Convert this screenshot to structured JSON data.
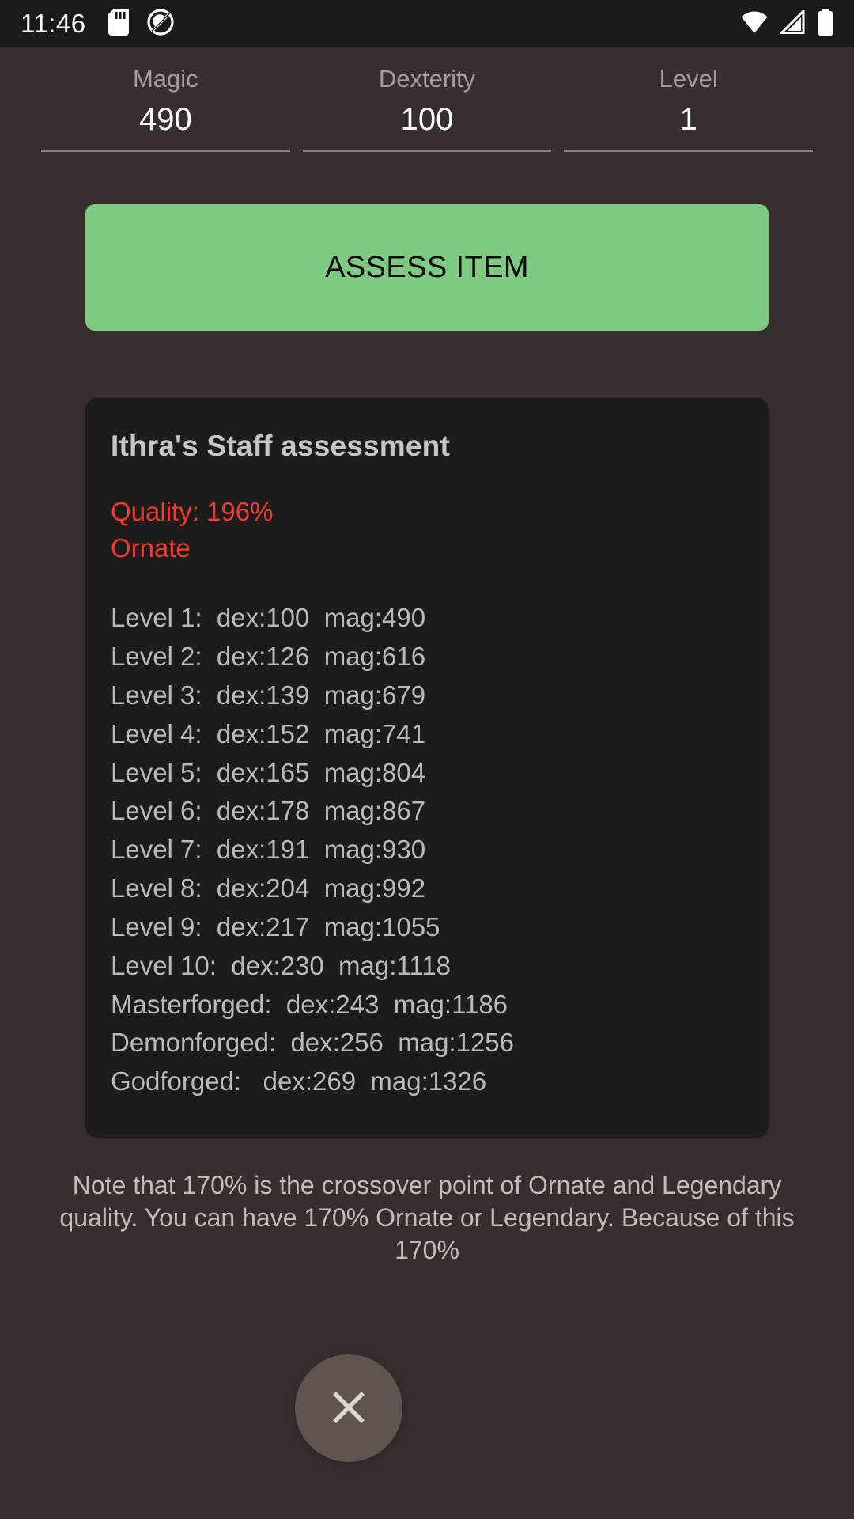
{
  "status_bar": {
    "time": "11:46",
    "left_icons": [
      "sd-card-icon",
      "no-screenshot-icon"
    ],
    "right_icons": [
      "wifi-icon",
      "signal-icon",
      "battery-icon"
    ]
  },
  "fields": [
    {
      "label": "Magic",
      "value": "490"
    },
    {
      "label": "Dexterity",
      "value": "100"
    },
    {
      "label": "Level",
      "value": "1"
    }
  ],
  "assess_button": {
    "label": "ASSESS ITEM",
    "color": "#7fc983"
  },
  "card": {
    "title": "Ithra's Staff assessment",
    "quality_label": "Quality: 196%",
    "quality_rank": "Ornate",
    "quality_color": "#ef3b30",
    "rows": [
      "Level 1:  dex:100  mag:490",
      "Level 2:  dex:126  mag:616",
      "Level 3:  dex:139  mag:679",
      "Level 4:  dex:152  mag:741",
      "Level 5:  dex:165  mag:804",
      "Level 6:  dex:178  mag:867",
      "Level 7:  dex:191  mag:930",
      "Level 8:  dex:204  mag:992",
      "Level 9:  dex:217  mag:1055",
      "Level 10:  dex:230  mag:1118",
      "Masterforged:  dex:243  mag:1186",
      "Demonforged:  dex:256  mag:1256",
      "Godforged:   dex:269  mag:1326"
    ]
  },
  "note": {
    "text": "Note that 170% is the crossover point of Ornate and Legendary quality. You can have 170% Ornate or Legendary. Because of this 170%"
  },
  "close_button": {
    "icon": "close-icon",
    "color": "#5e5551"
  }
}
